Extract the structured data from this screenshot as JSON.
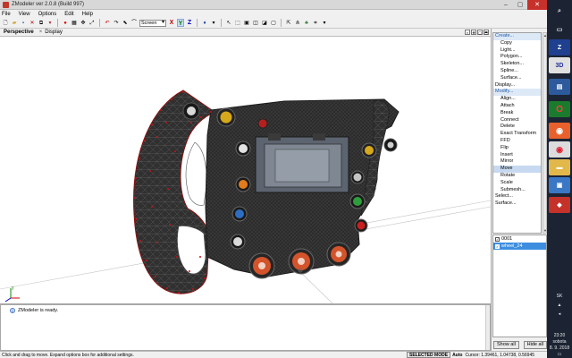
{
  "window": {
    "title": "ZModeler ver 2.0.8 (Build 997)",
    "min_icon": "minimize-icon",
    "max_icon": "maximize-icon",
    "close_icon": "close-icon"
  },
  "menu": [
    "File",
    "View",
    "Options",
    "Edit",
    "Help"
  ],
  "toolbar": {
    "view_select": "Screen",
    "axes": [
      "X",
      "Y",
      "Z"
    ]
  },
  "viewport": {
    "name": "Perspective",
    "close_glyph": "×",
    "display_label": "Display"
  },
  "commands": [
    {
      "label": "Create...",
      "level": "top",
      "state": "active",
      "dots": ""
    },
    {
      "label": "Copy",
      "level": "sub",
      "state": "",
      "dots": ""
    },
    {
      "label": "Light...",
      "level": "sub",
      "state": "",
      "dots": ""
    },
    {
      "label": "Polygon...",
      "level": "sub",
      "state": "",
      "dots": ""
    },
    {
      "label": "Skeleton...",
      "level": "sub",
      "state": "",
      "dots": ""
    },
    {
      "label": "Spline...",
      "level": "sub",
      "state": "",
      "dots": ""
    },
    {
      "label": "Surface...",
      "level": "sub",
      "state": "",
      "dots": ""
    },
    {
      "label": "Display...",
      "level": "top",
      "state": "",
      "dots": ""
    },
    {
      "label": "Modify...",
      "level": "top",
      "state": "active",
      "dots": ""
    },
    {
      "label": "Align...",
      "level": "sub",
      "state": "",
      "dots": ""
    },
    {
      "label": "Attach",
      "level": "sub",
      "state": "",
      "dots": ""
    },
    {
      "label": "Break",
      "level": "sub",
      "state": "",
      "dots": ""
    },
    {
      "label": "Connect",
      "level": "sub",
      "state": "",
      "dots": ""
    },
    {
      "label": "Delete",
      "level": "sub",
      "state": "",
      "dots": ""
    },
    {
      "label": "Exact Transform",
      "level": "sub",
      "state": "",
      "dots": ""
    },
    {
      "label": "FFD",
      "level": "sub",
      "state": "",
      "dots": ""
    },
    {
      "label": "Flip",
      "level": "sub",
      "state": "",
      "dots": ""
    },
    {
      "label": "Insert",
      "level": "sub",
      "state": "",
      "dots": ""
    },
    {
      "label": "Mirror",
      "level": "sub",
      "state": "",
      "dots": ""
    },
    {
      "label": "Move",
      "level": "sub",
      "state": "highlight",
      "dots": ""
    },
    {
      "label": "Rotate",
      "level": "sub",
      "state": "",
      "dots": ""
    },
    {
      "label": "Scale",
      "level": "sub",
      "state": "",
      "dots": ""
    },
    {
      "label": "Submesh...",
      "level": "sub",
      "state": "",
      "dots": ""
    },
    {
      "label": "Select...",
      "level": "top",
      "state": "",
      "dots": ""
    },
    {
      "label": "Surface...",
      "level": "top",
      "state": "",
      "dots": ""
    }
  ],
  "objects": [
    {
      "name": "0001",
      "checked": "✓",
      "selected": false
    },
    {
      "name": "wheel_24",
      "checked": "✓",
      "selected": true
    }
  ],
  "panel_buttons": {
    "show_all": "Show all",
    "hide_all": "Hide all"
  },
  "log": {
    "message": "ZModeler is ready."
  },
  "status": {
    "hint": "Click and drag to move. Expand options box for additional settings.",
    "mode": "SELECTED MODE",
    "auto": "Auto",
    "cursor": "Cursor: 1.39461, 1.04738, 0.56945"
  },
  "taskbar": {
    "lang": "SK",
    "time": "23:20",
    "day": "sobota",
    "date": "8. 9. 2018"
  }
}
